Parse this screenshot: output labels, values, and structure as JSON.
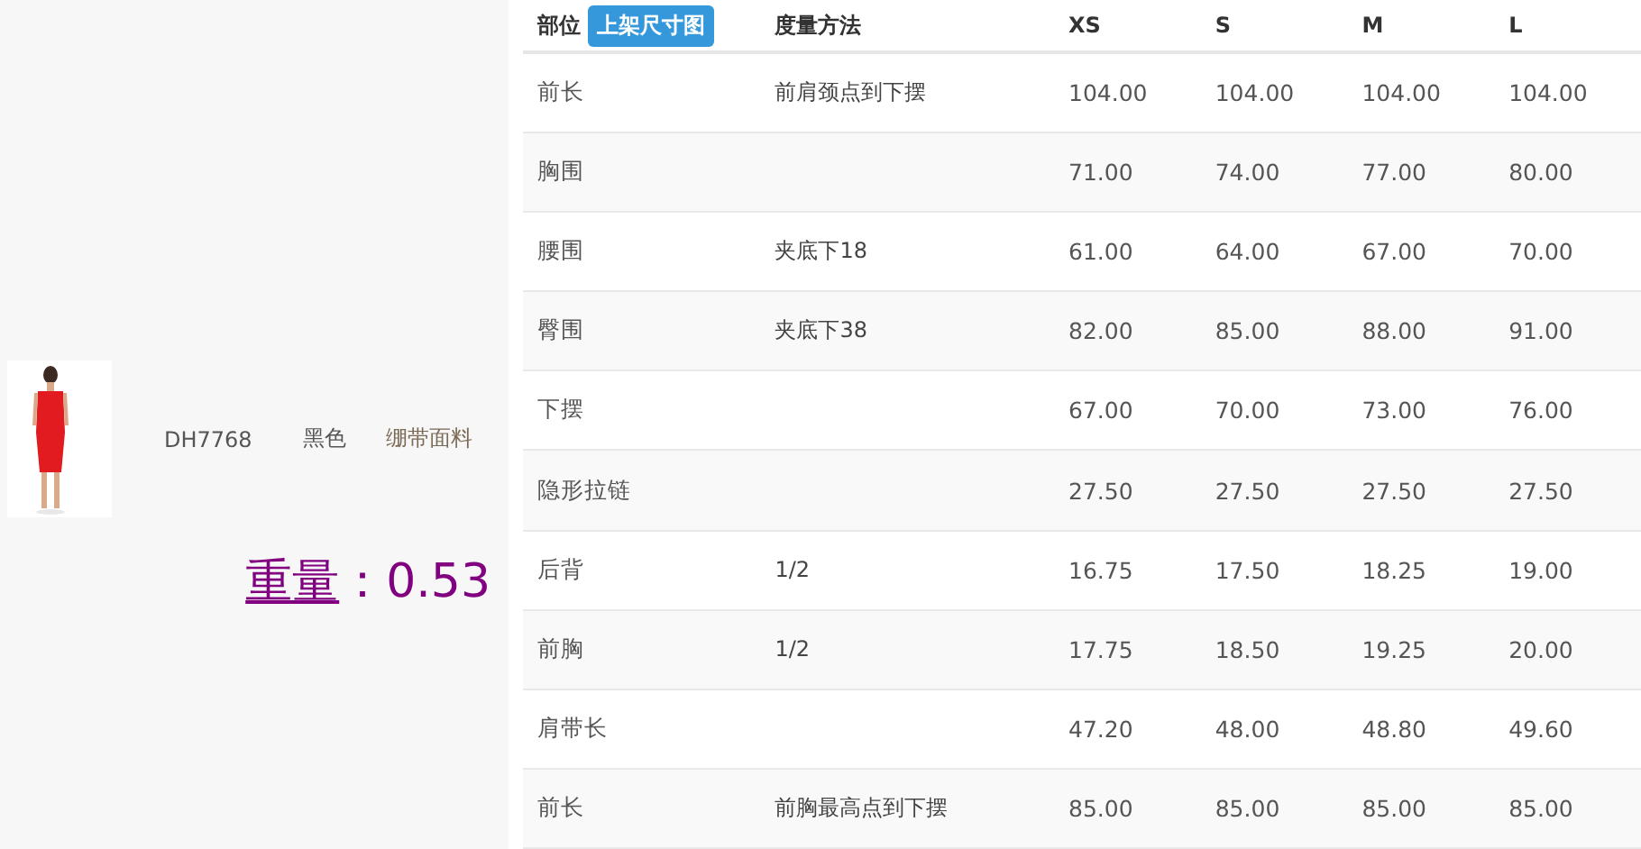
{
  "product": {
    "code": "DH7768",
    "color_name": "黑色",
    "fabric": "绷带面料",
    "weight_label": "重量",
    "weight_value": "：0.53"
  },
  "table": {
    "columns": [
      "部位",
      "度量方法",
      "XS",
      "S",
      "M",
      "L"
    ],
    "chart_button": "上架尺寸图",
    "rows": [
      {
        "part": "前长",
        "method": "前肩颈点到下摆",
        "values": [
          "104.00",
          "104.00",
          "104.00",
          "104.00"
        ]
      },
      {
        "part": "胸围",
        "values": [
          "71.00",
          "74.00",
          "77.00",
          "80.00"
        ]
      },
      {
        "part": "腰围",
        "method": "夹底下18",
        "values": [
          "61.00",
          "64.00",
          "67.00",
          "70.00"
        ]
      },
      {
        "part": "臀围",
        "method": "夹底下38",
        "values": [
          "82.00",
          "85.00",
          "88.00",
          "91.00"
        ]
      },
      {
        "part": "下摆",
        "values": [
          "67.00",
          "70.00",
          "73.00",
          "76.00"
        ]
      },
      {
        "part": "隐形拉链",
        "values": [
          "27.50",
          "27.50",
          "27.50",
          "27.50"
        ]
      },
      {
        "part": "后背",
        "method": "1/2",
        "values": [
          "16.75",
          "17.50",
          "18.25",
          "19.00"
        ]
      },
      {
        "part": "前胸",
        "method": "1/2",
        "values": [
          "17.75",
          "18.50",
          "19.25",
          "20.00"
        ]
      },
      {
        "part": "肩带长",
        "values": [
          "47.20",
          "48.00",
          "48.80",
          "49.60"
        ]
      },
      {
        "part": "前长",
        "method": "前胸最高点到下摆",
        "values": [
          "85.00",
          "85.00",
          "85.00",
          "85.00"
        ]
      }
    ]
  }
}
